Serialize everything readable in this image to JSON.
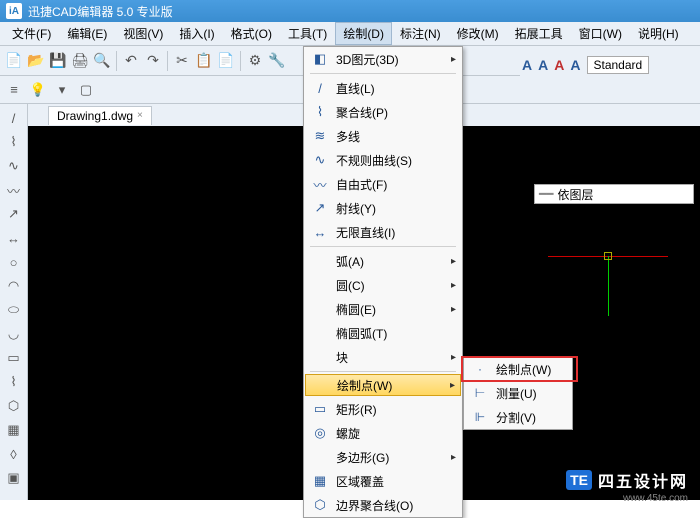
{
  "title": "迅捷CAD编辑器 5.0 专业版",
  "logo": "iA",
  "menubar": [
    "文件(F)",
    "编辑(E)",
    "视图(V)",
    "插入(I)",
    "格式(O)",
    "工具(T)",
    "绘制(D)",
    "标注(N)",
    "修改(M)",
    "拓展工具",
    "窗口(W)",
    "说明(H)"
  ],
  "tab": {
    "name": "Drawing1.dwg",
    "close": "×"
  },
  "layer_label": "依图层",
  "style_label": "Standard",
  "dropdown": {
    "items": [
      {
        "icon": "◧",
        "label": "3D图元(3D)",
        "arrow": true
      },
      {
        "sep": true
      },
      {
        "icon": "/",
        "label": "直线(L)"
      },
      {
        "icon": "⌇",
        "label": "聚合线(P)"
      },
      {
        "icon": "≋",
        "label": "多线"
      },
      {
        "icon": "∿",
        "label": "不规则曲线(S)"
      },
      {
        "icon": "〰",
        "label": "自由式(F)"
      },
      {
        "icon": "↗",
        "label": "射线(Y)"
      },
      {
        "icon": "↔",
        "label": "无限直线(I)"
      },
      {
        "sep": true
      },
      {
        "icon": "",
        "label": "弧(A)",
        "arrow": true
      },
      {
        "icon": "",
        "label": "圆(C)",
        "arrow": true
      },
      {
        "icon": "",
        "label": "椭圆(E)",
        "arrow": true
      },
      {
        "icon": "",
        "label": "椭圆弧(T)"
      },
      {
        "icon": "",
        "label": "块",
        "arrow": true
      },
      {
        "sep": true
      },
      {
        "icon": "",
        "label": "绘制点(W)",
        "arrow": true,
        "hl": true
      },
      {
        "icon": "▭",
        "label": "矩形(R)"
      },
      {
        "icon": "◎",
        "label": "螺旋"
      },
      {
        "icon": "",
        "label": "多边形(G)",
        "arrow": true
      },
      {
        "icon": "▦",
        "label": "区域覆盖"
      },
      {
        "icon": "⬡",
        "label": "边界聚合线(O)"
      }
    ]
  },
  "submenu": {
    "items": [
      {
        "icon": "·",
        "label": "绘制点(W)"
      },
      {
        "icon": "⊢",
        "label": "测量(U)"
      },
      {
        "icon": "⊩",
        "label": "分割(V)"
      }
    ]
  },
  "watermark": {
    "badge": "TE",
    "zh": "四五设计网",
    "url": "www.45te.com"
  }
}
